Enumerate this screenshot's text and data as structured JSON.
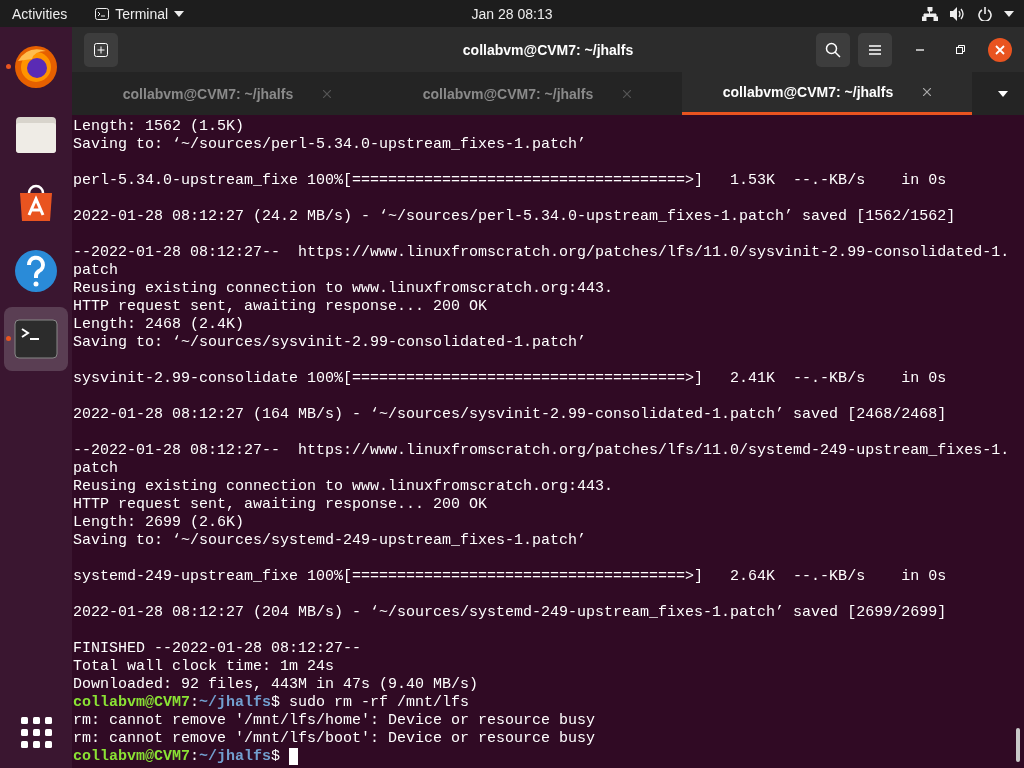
{
  "top_bar": {
    "activities": "Activities",
    "app_menu": "Terminal",
    "clock": "Jan 28  08:13"
  },
  "dock": {
    "items": [
      {
        "kind": "firefox",
        "running": true,
        "selected": false
      },
      {
        "kind": "files",
        "running": false,
        "selected": false
      },
      {
        "kind": "software",
        "running": false,
        "selected": false
      },
      {
        "kind": "help",
        "running": false,
        "selected": false
      },
      {
        "kind": "terminal",
        "running": true,
        "selected": true
      }
    ]
  },
  "window": {
    "title": "collabvm@CVM7: ~/jhalfs",
    "tabs": [
      {
        "label": "collabvm@CVM7: ~/jhalfs",
        "selected": false
      },
      {
        "label": "collabvm@CVM7: ~/jhalfs",
        "selected": false
      },
      {
        "label": "collabvm@CVM7: ~/jhalfs",
        "selected": true
      }
    ],
    "terminal": {
      "lines": [
        {
          "kind": "text",
          "text": "Length: 1562 (1.5K)"
        },
        {
          "kind": "text",
          "text": "Saving to: ‘~/sources/perl-5.34.0-upstream_fixes-1.patch’"
        },
        {
          "kind": "blank"
        },
        {
          "kind": "text",
          "text": "perl-5.34.0-upstream_fixe 100%[=====================================>]   1.53K  --.-KB/s    in 0s"
        },
        {
          "kind": "blank"
        },
        {
          "kind": "text",
          "text": "2022-01-28 08:12:27 (24.2 MB/s) - ‘~/sources/perl-5.34.0-upstream_fixes-1.patch’ saved [1562/1562]"
        },
        {
          "kind": "blank"
        },
        {
          "kind": "text",
          "text": "--2022-01-28 08:12:27--  https://www.linuxfromscratch.org/patches/lfs/11.0/sysvinit-2.99-consolidated-1."
        },
        {
          "kind": "text",
          "text": "patch"
        },
        {
          "kind": "text",
          "text": "Reusing existing connection to www.linuxfromscratch.org:443."
        },
        {
          "kind": "text",
          "text": "HTTP request sent, awaiting response... 200 OK"
        },
        {
          "kind": "text",
          "text": "Length: 2468 (2.4K)"
        },
        {
          "kind": "text",
          "text": "Saving to: ‘~/sources/sysvinit-2.99-consolidated-1.patch’"
        },
        {
          "kind": "blank"
        },
        {
          "kind": "text",
          "text": "sysvinit-2.99-consolidate 100%[=====================================>]   2.41K  --.-KB/s    in 0s"
        },
        {
          "kind": "blank"
        },
        {
          "kind": "text",
          "text": "2022-01-28 08:12:27 (164 MB/s) - ‘~/sources/sysvinit-2.99-consolidated-1.patch’ saved [2468/2468]"
        },
        {
          "kind": "blank"
        },
        {
          "kind": "text",
          "text": "--2022-01-28 08:12:27--  https://www.linuxfromscratch.org/patches/lfs/11.0/systemd-249-upstream_fixes-1."
        },
        {
          "kind": "text",
          "text": "patch"
        },
        {
          "kind": "text",
          "text": "Reusing existing connection to www.linuxfromscratch.org:443."
        },
        {
          "kind": "text",
          "text": "HTTP request sent, awaiting response... 200 OK"
        },
        {
          "kind": "text",
          "text": "Length: 2699 (2.6K)"
        },
        {
          "kind": "text",
          "text": "Saving to: ‘~/sources/systemd-249-upstream_fixes-1.patch’"
        },
        {
          "kind": "blank"
        },
        {
          "kind": "text",
          "text": "systemd-249-upstream_fixe 100%[=====================================>]   2.64K  --.-KB/s    in 0s"
        },
        {
          "kind": "blank"
        },
        {
          "kind": "text",
          "text": "2022-01-28 08:12:27 (204 MB/s) - ‘~/sources/systemd-249-upstream_fixes-1.patch’ saved [2699/2699]"
        },
        {
          "kind": "blank"
        },
        {
          "kind": "text",
          "text": "FINISHED --2022-01-28 08:12:27--"
        },
        {
          "kind": "text",
          "text": "Total wall clock time: 1m 24s"
        },
        {
          "kind": "text",
          "text": "Downloaded: 92 files, 443M in 47s (9.40 MB/s)"
        },
        {
          "kind": "prompt",
          "user": "collabvm@CVM7",
          "sep": ":",
          "path": "~/jhalfs",
          "symbol": "$",
          "command": "sudo rm -rf /mnt/lfs",
          "cursor": false
        },
        {
          "kind": "text",
          "text": "rm: cannot remove '/mnt/lfs/home': Device or resource busy"
        },
        {
          "kind": "text",
          "text": "rm: cannot remove '/mnt/lfs/boot': Device or resource busy"
        },
        {
          "kind": "prompt",
          "user": "collabvm@CVM7",
          "sep": ":",
          "path": "~/jhalfs",
          "symbol": "$",
          "cursor": true
        }
      ]
    }
  }
}
